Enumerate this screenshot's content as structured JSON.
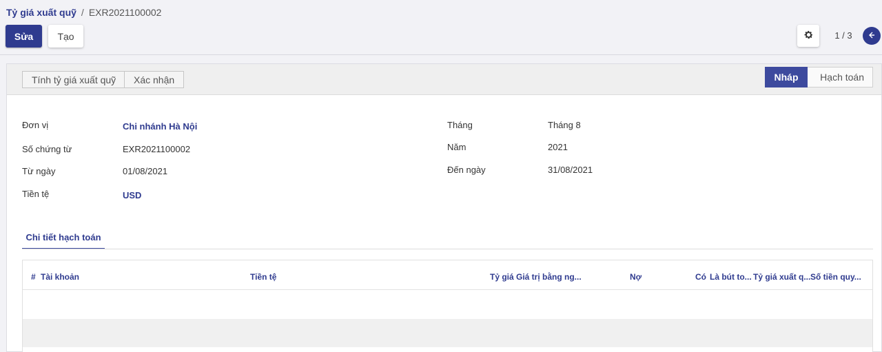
{
  "breadcrumb": {
    "parent": "Tỷ giá xuất quỹ",
    "separator": "/",
    "current": "EXR2021100002"
  },
  "toolbar": {
    "edit_label": "Sửa",
    "create_label": "Tạo"
  },
  "pager": {
    "text": "1 / 3"
  },
  "actions": {
    "calc_label": "Tính tỷ giá xuất quỹ",
    "confirm_label": "Xác nhận"
  },
  "status": {
    "stages": [
      "Nháp",
      "Hạch toán"
    ],
    "active": "Nháp"
  },
  "form": {
    "don_vi_label": "Đơn vị",
    "don_vi_value": "Chi nhánh Hà Nội",
    "so_chung_tu_label": "Số chứng từ",
    "so_chung_tu_value": "EXR2021100002",
    "tu_ngay_label": "Từ ngày",
    "tu_ngay_value": "01/08/2021",
    "tien_te_label": "Tiền tệ",
    "tien_te_value": "USD",
    "thang_label": "Tháng",
    "thang_value": "Tháng 8",
    "nam_label": "Năm",
    "nam_value": "2021",
    "den_ngay_label": "Đến ngày",
    "den_ngay_value": "31/08/2021"
  },
  "tabs": [
    {
      "label": "Chi tiết hạch toán"
    }
  ],
  "table": {
    "columns": [
      "#",
      "Tài khoản",
      "Tiền tệ",
      "Tỷ giá",
      "Giá trị bằng ng...",
      "Nợ",
      "Có",
      "Là bút to...",
      "Tỷ giá xuất q...",
      "Số tiền quy..."
    ]
  },
  "colors": {
    "primary": "#2f3b8f",
    "stage_active": "#3d4a9e",
    "background": "#f2f2f6"
  },
  "icons": [
    "gear-icon",
    "arrow-left-icon"
  ]
}
